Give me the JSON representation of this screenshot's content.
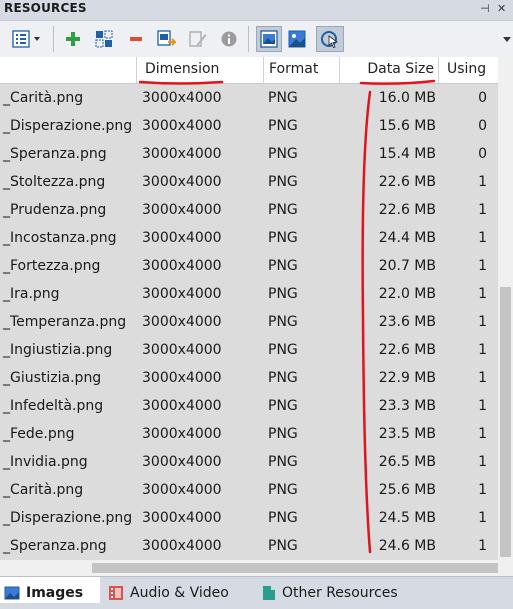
{
  "panel": {
    "title": "RESOURCES",
    "pin_glyph": "⊣",
    "close_glyph": "✕"
  },
  "toolbar": {
    "icons": [
      "list-view-icon",
      "add-icon",
      "select-all-icon",
      "remove-icon",
      "import-icon",
      "edit-icon",
      "info-icon",
      "image-frame-icon",
      "image-icon",
      "locate-icon"
    ]
  },
  "columns": {
    "name": "",
    "dimension": "Dimension",
    "format": "Format",
    "data_size": "Data Size",
    "using": "Using"
  },
  "rows": [
    {
      "name": "_Carità.png",
      "dimension": "3000x4000",
      "format": "PNG",
      "size": "16.0 MB",
      "using": "0"
    },
    {
      "name": "_Disperazione.png",
      "dimension": "3000x4000",
      "format": "PNG",
      "size": "15.6 MB",
      "using": "0"
    },
    {
      "name": "_Speranza.png",
      "dimension": "3000x4000",
      "format": "PNG",
      "size": "15.4 MB",
      "using": "0"
    },
    {
      "name": "_Stoltezza.png",
      "dimension": "3000x4000",
      "format": "PNG",
      "size": "22.6 MB",
      "using": "1"
    },
    {
      "name": "_Prudenza.png",
      "dimension": "3000x4000",
      "format": "PNG",
      "size": "22.6 MB",
      "using": "1"
    },
    {
      "name": "_Incostanza.png",
      "dimension": "3000x4000",
      "format": "PNG",
      "size": "24.4 MB",
      "using": "1"
    },
    {
      "name": "_Fortezza.png",
      "dimension": "3000x4000",
      "format": "PNG",
      "size": "20.7 MB",
      "using": "1"
    },
    {
      "name": "_Ira.png",
      "dimension": "3000x4000",
      "format": "PNG",
      "size": "22.0 MB",
      "using": "1"
    },
    {
      "name": "_Temperanza.png",
      "dimension": "3000x4000",
      "format": "PNG",
      "size": "23.6 MB",
      "using": "1"
    },
    {
      "name": "_Ingiustizia.png",
      "dimension": "3000x4000",
      "format": "PNG",
      "size": "22.6 MB",
      "using": "1"
    },
    {
      "name": "_Giustizia.png",
      "dimension": "3000x4000",
      "format": "PNG",
      "size": "22.9 MB",
      "using": "1"
    },
    {
      "name": "_Infedeltà.png",
      "dimension": "3000x4000",
      "format": "PNG",
      "size": "23.3 MB",
      "using": "1"
    },
    {
      "name": "_Fede.png",
      "dimension": "3000x4000",
      "format": "PNG",
      "size": "23.5 MB",
      "using": "1"
    },
    {
      "name": "_Invidia.png",
      "dimension": "3000x4000",
      "format": "PNG",
      "size": "26.5 MB",
      "using": "1"
    },
    {
      "name": "_Carità.png",
      "dimension": "3000x4000",
      "format": "PNG",
      "size": "25.6 MB",
      "using": "1"
    },
    {
      "name": "_Disperazione.png",
      "dimension": "3000x4000",
      "format": "PNG",
      "size": "24.5 MB",
      "using": "1"
    },
    {
      "name": "_Speranza.png",
      "dimension": "3000x4000",
      "format": "PNG",
      "size": "24.6 MB",
      "using": "1"
    }
  ],
  "tabs": [
    {
      "label": "Images",
      "icon": "images-icon",
      "active": true
    },
    {
      "label": "Audio & Video",
      "icon": "film-icon",
      "active": false
    },
    {
      "label": "Other Resources",
      "icon": "document-icon",
      "active": false
    }
  ],
  "annotation": {
    "color": "#e0141e"
  }
}
